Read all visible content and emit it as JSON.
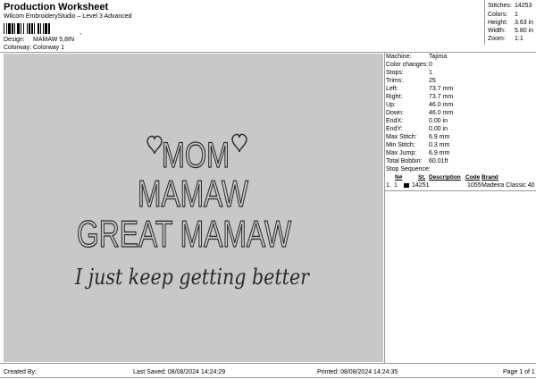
{
  "header": {
    "title": "Production Worksheet",
    "subtitle": "Wilcom EmbroideryStudio – Level 3 Advanced",
    "barcode_text": ","
  },
  "meta": {
    "design_label": "Design:",
    "design_value": "MAMAW 5,8IN",
    "colorway_label": "Colorway:",
    "colorway_value": "Colorway 1"
  },
  "stats": {
    "stitches_label": "Stitches:",
    "stitches_value": "14253",
    "colors_label": "Colors:",
    "colors_value": "1",
    "height_label": "Height:",
    "height_value": "3.63 in",
    "width_label": "Width:",
    "width_value": "5.80 in",
    "zoom_label": "Zoom:",
    "zoom_value": "1:1"
  },
  "design": {
    "line1": "MOM",
    "line2": "MAMAW",
    "line3": "GREAT MAMAW",
    "line4": "I just keep getting better",
    "background": "#c8c8c8",
    "thread_color": "#2a2a2a"
  },
  "params": {
    "machine_label": "Machine:",
    "machine_value": "Tajima",
    "color_changes_label": "Color changes:",
    "color_changes_value": "0",
    "stops_label": "Stops:",
    "stops_value": "1",
    "trims_label": "Trims:",
    "trims_value": "25",
    "left_label": "Left:",
    "left_value": "73.7 mm",
    "right_label": "Right:",
    "right_value": "73.7 mm",
    "up_label": "Up:",
    "up_value": "46.0 mm",
    "down_label": "Down:",
    "down_value": "46.0 mm",
    "endx_label": "EndX:",
    "endx_value": "0.00 in",
    "endy_label": "EndY:",
    "endy_value": "0.00 in",
    "max_stitch_label": "Max Stitch:",
    "max_stitch_value": "6.9 mm",
    "min_stitch_label": "Min Stitch:",
    "min_stitch_value": "0.3 mm",
    "max_jump_label": "Max Jump:",
    "max_jump_value": "6.9 mm",
    "total_bobbin_label": "Total Bobbin:",
    "total_bobbin_value": "60.01ft"
  },
  "stop_sequence": {
    "label": "Stop Sequence:",
    "headers": {
      "n": "N#",
      "st": "St.",
      "description": "Description",
      "code": "Code",
      "brand": "Brand"
    },
    "rows": [
      {
        "index": "1.",
        "n": "1",
        "swatch_color": "#000000",
        "st": "14251",
        "description": "",
        "code": "1055",
        "brand": "Madeira Classic 40"
      }
    ]
  },
  "footer": {
    "created_by": "Created By:",
    "last_saved": "Last Saved: 08/08/2024 14:24:29",
    "printed": "Printed: 08/08/2024 14:24:35",
    "page": "Page 1 of 1"
  }
}
